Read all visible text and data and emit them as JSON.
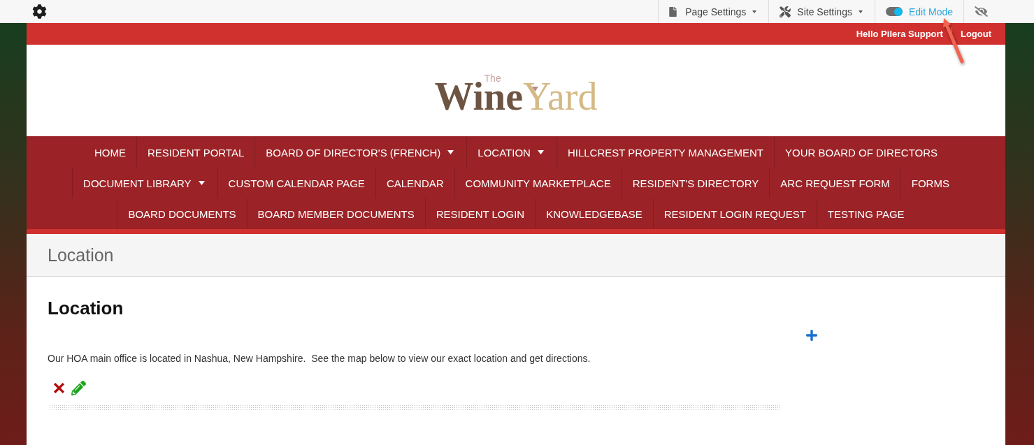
{
  "admin_bar": {
    "menus": [
      {
        "label": "Page Settings",
        "kind": "dropdown"
      },
      {
        "label": "Site Settings",
        "kind": "dropdown"
      }
    ],
    "edit_mode": {
      "label": "Edit Mode",
      "on": true
    }
  },
  "header": {
    "greeting": "Hello Pilera Support",
    "logout": "Logout"
  },
  "logo": {
    "prefix": "The",
    "word_1": "Wine",
    "word_2": "Yard"
  },
  "nav": {
    "items": [
      {
        "label": "HOME",
        "dropdown": false
      },
      {
        "label": "RESIDENT PORTAL",
        "dropdown": false
      },
      {
        "label": "BOARD OF DIRECTOR'S (FRENCH)",
        "dropdown": true
      },
      {
        "label": "LOCATION",
        "dropdown": true
      },
      {
        "label": "HILLCREST PROPERTY MANAGEMENT",
        "dropdown": false
      },
      {
        "label": "YOUR BOARD OF DIRECTORS",
        "dropdown": false
      },
      {
        "label": "DOCUMENT LIBRARY",
        "dropdown": true
      },
      {
        "label": "CUSTOM CALENDAR PAGE",
        "dropdown": false
      },
      {
        "label": "CALENDAR",
        "dropdown": false
      },
      {
        "label": "COMMUNITY MARKETPLACE",
        "dropdown": false
      },
      {
        "label": "RESIDENT'S DIRECTORY",
        "dropdown": false
      },
      {
        "label": "ARC REQUEST FORM",
        "dropdown": false
      },
      {
        "label": "FORMS",
        "dropdown": false
      },
      {
        "label": "BOARD DOCUMENTS",
        "dropdown": false
      },
      {
        "label": "BOARD MEMBER DOCUMENTS",
        "dropdown": false
      },
      {
        "label": "RESIDENT LOGIN",
        "dropdown": false
      },
      {
        "label": "KNOWLEDGEBASE",
        "dropdown": false
      },
      {
        "label": "RESIDENT LOGIN REQUEST",
        "dropdown": false
      },
      {
        "label": "TESTING PAGE",
        "dropdown": false
      }
    ]
  },
  "page_title": "Location",
  "content": {
    "heading": "Location",
    "text": "Our HOA main office is located in Nashua, New Hampshire.  See the map below to view our exact location and get directions."
  }
}
